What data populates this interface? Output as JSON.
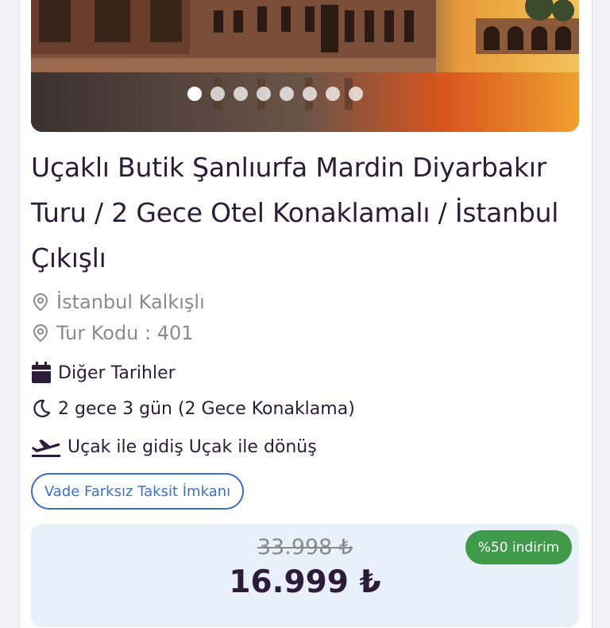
{
  "gallery": {
    "slide_count": 8,
    "active_index": 0
  },
  "tour": {
    "title": "Uçaklı Butik Şanlıurfa Mardin Diyarbakır Turu / 2 Gece Otel Konaklamalı / İstanbul Çıkışlı",
    "departure": "İstanbul Kalkışlı",
    "tour_code": "Tur Kodu : 401",
    "other_dates": "Diğer Tarihler",
    "duration": "2 gece 3 gün (2 Gece Konaklama)",
    "transport": "Uçak ile gidiş Uçak ile dönüş",
    "installment_label": "Vade Farksız Taksit İmkanı"
  },
  "price": {
    "old": "33.998 ₺",
    "new": "16.999 ₺",
    "discount_badge": "%50 indirim"
  },
  "colors": {
    "title": "#2c1c3a",
    "meta": "#8c8893",
    "accent_blue": "#3b71c9",
    "discount_green": "#3e9a49",
    "price_bg": "#e8f0fa"
  },
  "icons": {
    "departure": "location-pin-icon",
    "tour_code": "location-pin-icon",
    "other_dates": "calendar-icon",
    "duration": "moon-icon",
    "transport": "plane-departure-icon"
  }
}
